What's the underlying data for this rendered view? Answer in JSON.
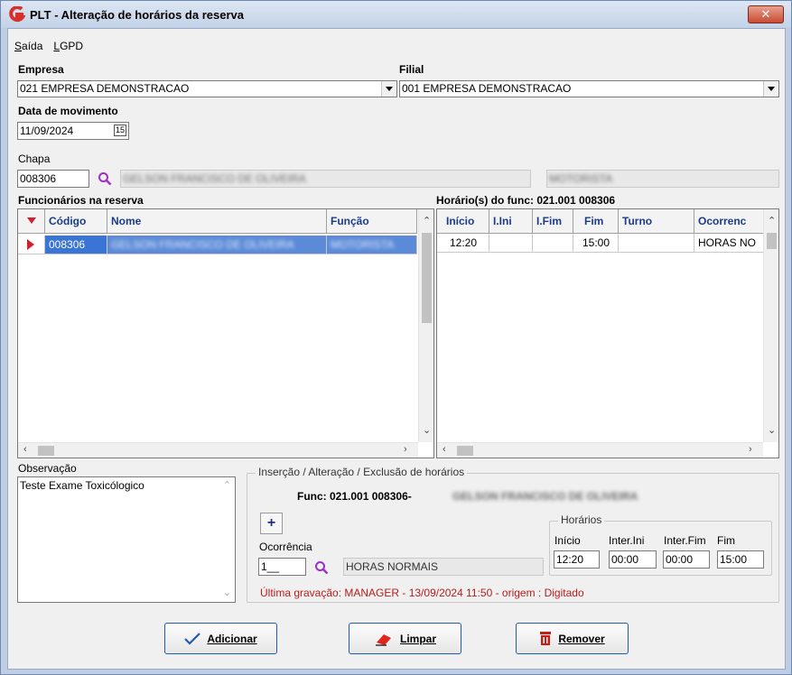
{
  "window": {
    "title": "PLT - Alteração de horários da reserva",
    "close": "✕"
  },
  "menu": [
    {
      "label": "Saída",
      "accel": "S"
    },
    {
      "label": "LGPD",
      "accel": "L"
    }
  ],
  "empresa": {
    "label": "Empresa",
    "value": "021 EMPRESA DEMONSTRACAO"
  },
  "filial": {
    "label": "Filial",
    "value": "001 EMPRESA DEMONSTRACAO"
  },
  "data_mov": {
    "label": "Data de movimento",
    "value": "11/09/2024",
    "cal_icon": "15"
  },
  "chapa": {
    "label": "Chapa",
    "value": "008306",
    "name_masked": "GELSON FRANCISCO DE OLIVEIRA",
    "funcao_masked": "MOTORISTA"
  },
  "funcionarios": {
    "title": "Funcionários na reserva",
    "columns": [
      "Código",
      "Nome",
      "Função"
    ],
    "rows": [
      {
        "codigo": "008306",
        "nome": "GELSON FRANCISCO DE OLIVEIRA",
        "funcao": "MOTORISTA"
      }
    ]
  },
  "horarios": {
    "title": "Horário(s) do func: 021.001   008306",
    "columns": [
      "Início",
      "I.Ini",
      "I.Fim",
      "Fim",
      "Turno",
      "Ocorrenc"
    ],
    "rows": [
      {
        "inicio": "12:20",
        "iini": "",
        "ifim": "",
        "fim": "15:00",
        "turno": "",
        "ocorrencia": "HORAS NO"
      }
    ]
  },
  "observacao": {
    "label": "Observação",
    "value": "Teste Exame Toxicólogico"
  },
  "insercao": {
    "title": "Inserção / Alteração / Exclusão de horários",
    "func_label": "Func: 021.001   008306-",
    "func_name_masked": "GELSON FRANCISCO DE OLIVEIRA",
    "plus": "+",
    "ocorrencia_label": "Ocorrência",
    "ocorrencia_code": "1__",
    "ocorrencia_desc": "HORAS NORMAIS",
    "horarios_group": "Horários",
    "inicio_label": "Início",
    "inicio": "12:20",
    "inter_ini_label": "Inter.Ini",
    "inter_ini": "00:00",
    "inter_fim_label": "Inter.Fim",
    "inter_fim": "00:00",
    "fim_label": "Fim",
    "fim": "15:00",
    "ultima": "Última gravação: MANAGER - 13/09/2024 11:50  - origem : Digitado"
  },
  "buttons": {
    "adicionar": "Adicionar",
    "limpar": "Limpar",
    "remover": "Remover"
  },
  "colors": {
    "accent": "#1f5cb0",
    "selection": "#3a74d6",
    "magnifier": "#9b2fc7",
    "logo": "#d8302a"
  }
}
